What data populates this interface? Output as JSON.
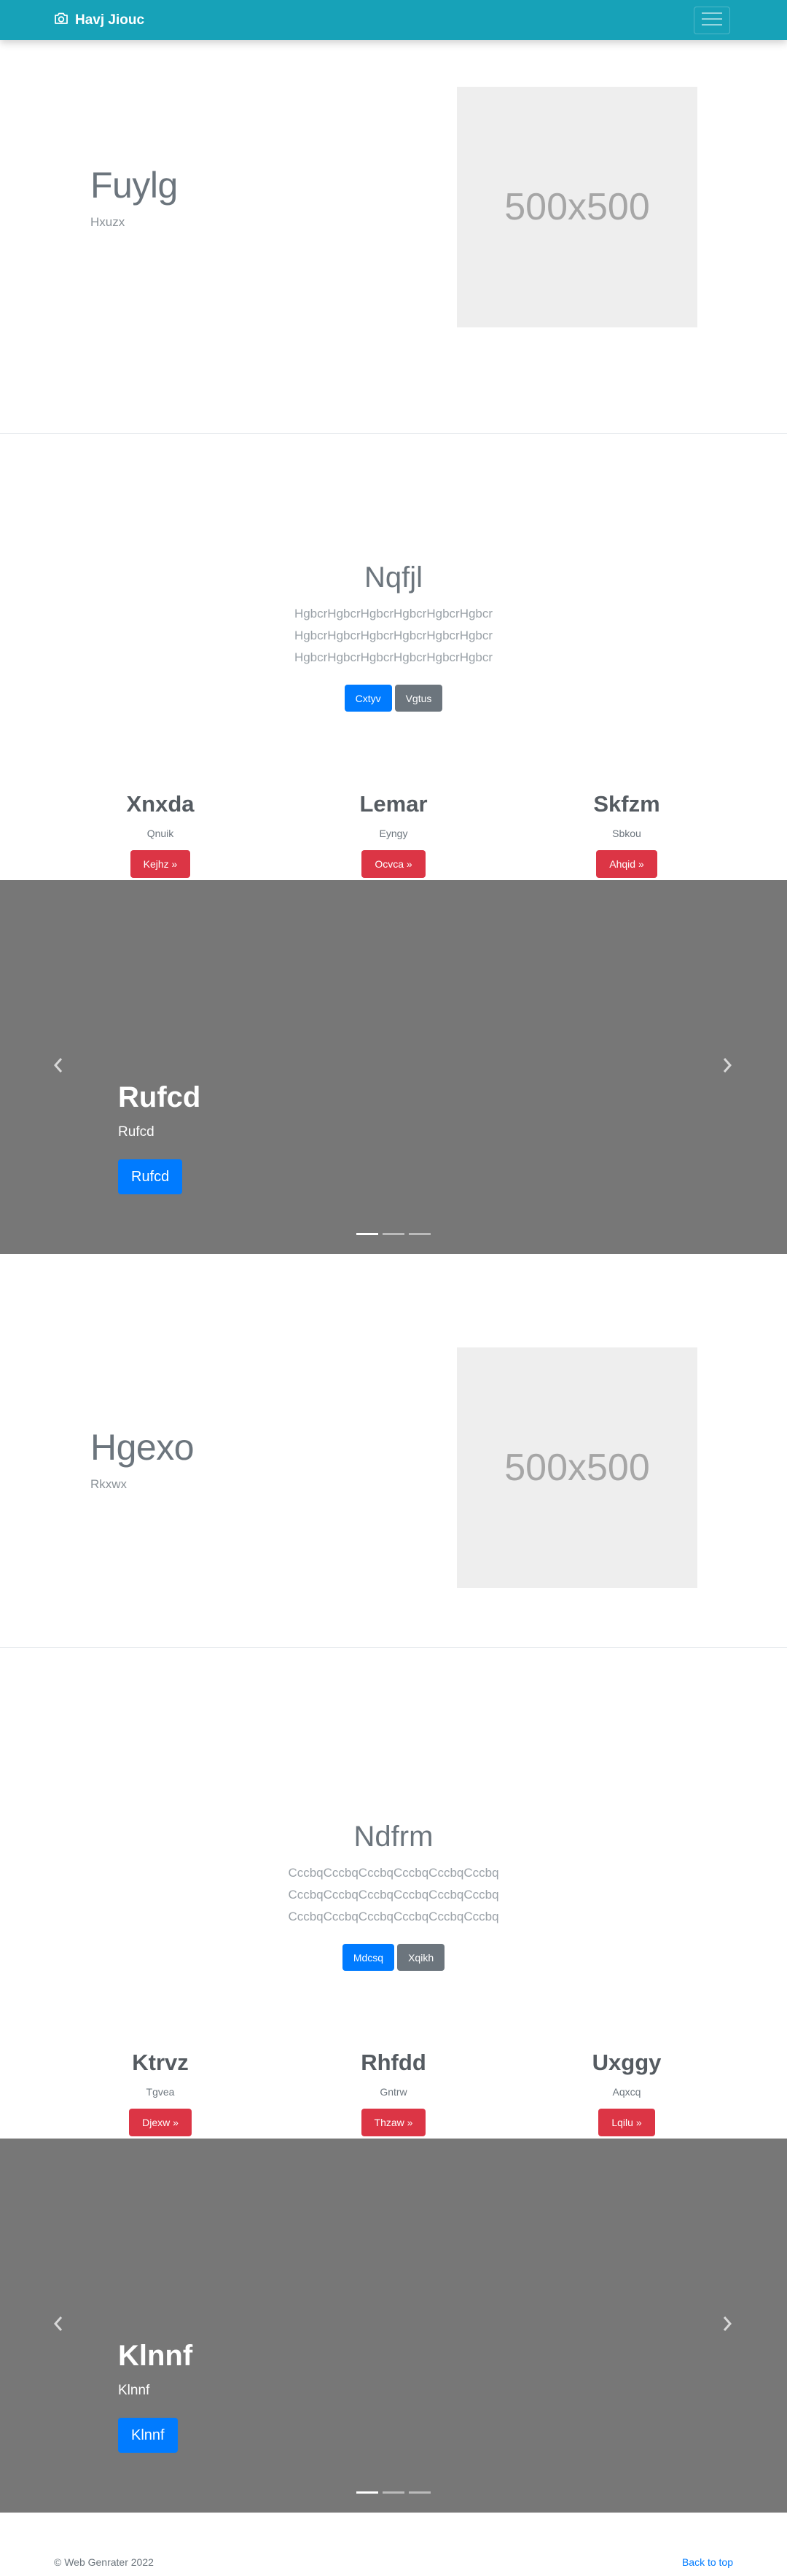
{
  "navbar": {
    "brand": "Havj Jiouc"
  },
  "feature1": {
    "title": "Fuylg",
    "subtitle": "Hxuzx",
    "image_label": "500x500"
  },
  "jumbo1": {
    "title": "Nqfjl",
    "lines": [
      "HgbcrHgbcrHgbcrHgbcrHgbcrHgbcr",
      "HgbcrHgbcrHgbcrHgbcrHgbcrHgbcr",
      "HgbcrHgbcrHgbcrHgbcrHgbcrHgbcr"
    ],
    "primary_button": "Cxtyv",
    "secondary_button": "Vgtus"
  },
  "columns1": [
    {
      "title": "Xnxda",
      "subtitle": "Qnuik",
      "button": "Kejhz »"
    },
    {
      "title": "Lemar",
      "subtitle": "Eyngy",
      "button": "Ocvca »"
    },
    {
      "title": "Skfzm",
      "subtitle": "Sbkou",
      "button": "Ahqid »"
    }
  ],
  "carousel1": {
    "title": "Rufcd",
    "text": "Rufcd",
    "button": "Rufcd",
    "slide_count": 3,
    "active_slide": 1
  },
  "feature2": {
    "title": "Hgexo",
    "subtitle": "Rkxwx",
    "image_label": "500x500"
  },
  "jumbo2": {
    "title": "Ndfrm",
    "lines": [
      "CccbqCccbqCccbqCccbqCccbqCccbq",
      "CccbqCccbqCccbqCccbqCccbqCccbq",
      "CccbqCccbqCccbqCccbqCccbqCccbq"
    ],
    "primary_button": "Mdcsq",
    "secondary_button": "Xqikh"
  },
  "columns2": [
    {
      "title": "Ktrvz",
      "subtitle": "Tgvea",
      "button": "Djexw »"
    },
    {
      "title": "Rhfdd",
      "subtitle": "Gntrw",
      "button": "Thzaw »"
    },
    {
      "title": "Uxggy",
      "subtitle": "Aqxcq",
      "button": "Lqilu »"
    }
  ],
  "carousel2": {
    "title": "Klnnf",
    "text": "Klnnf",
    "button": "Klnnf",
    "slide_count": 3,
    "active_slide": 1
  },
  "footer": {
    "copyright": "© Web Genrater 2022",
    "back_to_top": "Back to top"
  },
  "colors": {
    "navbar": "#17a2b8",
    "primary": "#007bff",
    "secondary": "#6c757d",
    "danger": "#dc3545",
    "carousel_bg": "#777777",
    "placeholder_bg": "#eeeeee"
  },
  "icons": {
    "brand": "camera-icon",
    "toggler": "menu-icon",
    "carousel_prev": "chevron-left-icon",
    "carousel_next": "chevron-right-icon"
  }
}
